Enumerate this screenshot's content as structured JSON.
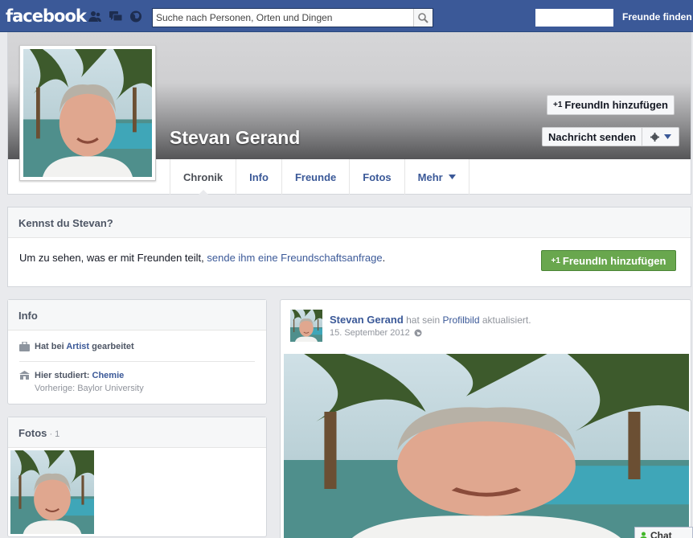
{
  "topbar": {
    "logo": "facebook",
    "search_placeholder": "Suche nach Personen, Orten und Dingen",
    "find_friends": "Freunde finden",
    "colors": {
      "bar": "#3b5998"
    }
  },
  "profile": {
    "name": "Stevan Gerand",
    "add_friend": "FreundIn hinzufügen",
    "plus_one": "+1",
    "message": "Nachricht senden",
    "tabs": [
      "Chronik",
      "Info",
      "Freunde",
      "Fotos",
      "Mehr"
    ]
  },
  "know": {
    "title": "Kennst du Stevan?",
    "text_before": "Um zu sehen, was er mit Freunden teilt, ",
    "link": "sende ihm eine Freundschaftsanfrage",
    "text_after": ".",
    "button": "FreundIn hinzufügen",
    "button_color": "#69a74e"
  },
  "info": {
    "title": "Info",
    "work_prefix": "Hat bei ",
    "work_place": "Artist",
    "work_suffix": " gearbeitet",
    "study_prefix": "Hier studiert: ",
    "study_subject": "Chemie",
    "previous": "Vorherige: Baylor University"
  },
  "photos": {
    "title": "Fotos",
    "count": " · 1"
  },
  "post": {
    "author": "Stevan Gerand",
    "action_prefix": " hat sein ",
    "action_link": "Profilbild",
    "action_suffix": " aktualisiert.",
    "date": "15. September 2012"
  },
  "chat": {
    "label": "Chat"
  }
}
